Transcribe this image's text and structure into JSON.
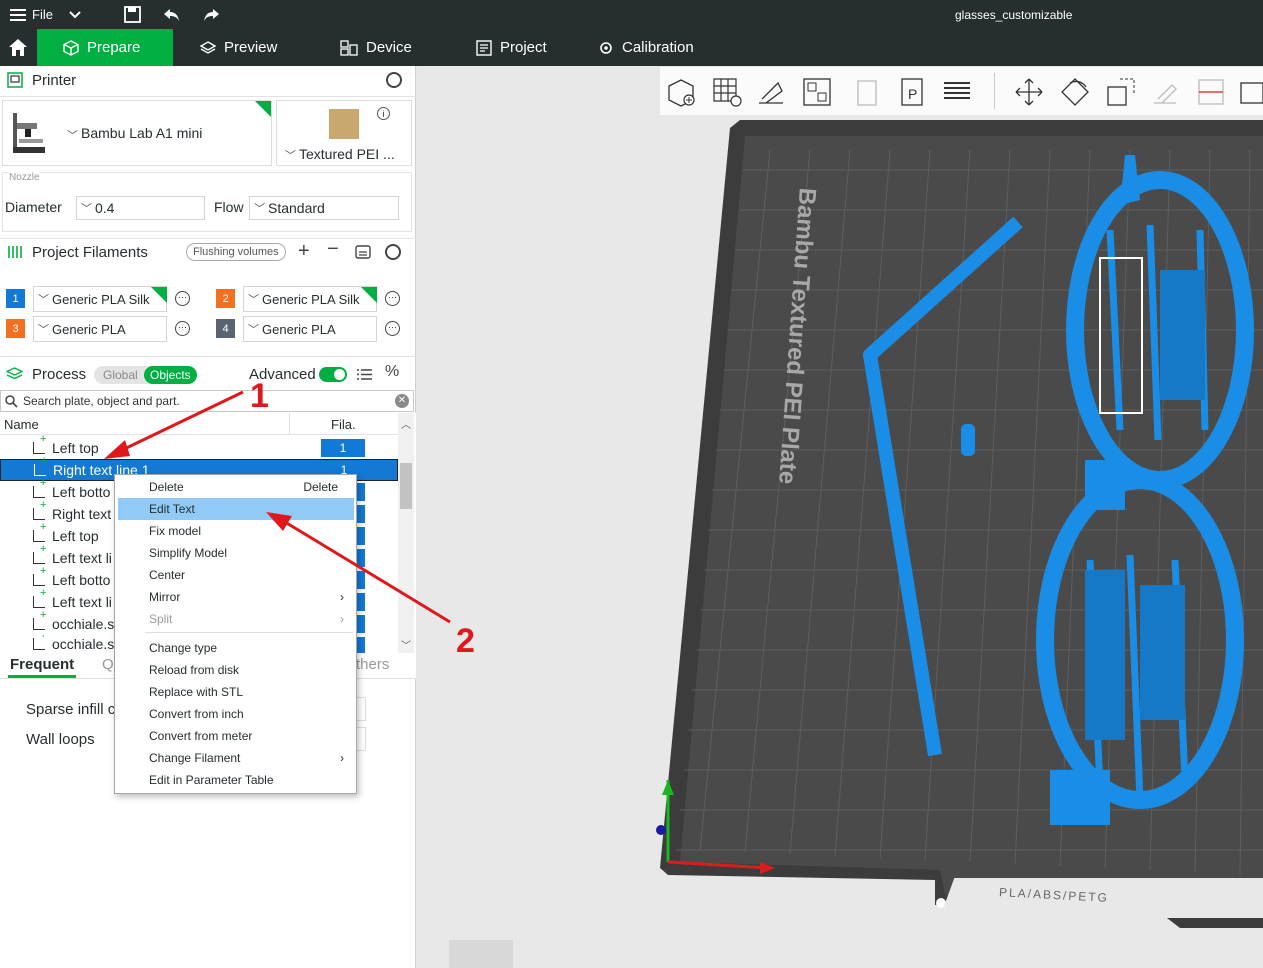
{
  "titlebar": {
    "menu_label": "File",
    "doc_title": "glasses_customizable"
  },
  "tabs": [
    {
      "label": "Prepare",
      "icon": "cube-icon",
      "active": true
    },
    {
      "label": "Preview",
      "icon": "layers-icon",
      "active": false
    },
    {
      "label": "Device",
      "icon": "device-icon",
      "active": false
    },
    {
      "label": "Project",
      "icon": "project-icon",
      "active": false
    },
    {
      "label": "Calibration",
      "icon": "calibration-icon",
      "active": false
    }
  ],
  "printer": {
    "section_title": "Printer",
    "model": "Bambu Lab A1 mini",
    "plate": "Textured PEI ...",
    "nozzle_label": "Nozzle",
    "diameter_label": "Diameter",
    "diameter_value": "0.4",
    "flow_label": "Flow",
    "flow_value": "Standard"
  },
  "filaments": {
    "section_title": "Project Filaments",
    "flushing_label": "Flushing volumes",
    "items": [
      {
        "num": "1",
        "name": "Generic PLA Silk",
        "color": "#1479d2"
      },
      {
        "num": "2",
        "name": "Generic PLA Silk",
        "color": "#f37021"
      },
      {
        "num": "3",
        "name": "Generic PLA",
        "color": "#f37021"
      },
      {
        "num": "4",
        "name": "Generic PLA",
        "color": "#5a6470"
      }
    ]
  },
  "process": {
    "section_title": "Process",
    "global_label": "Global",
    "objects_label": "Objects",
    "advanced_label": "Advanced",
    "search_placeholder": "Search plate, object and part."
  },
  "objects": {
    "col_name": "Name",
    "col_fila": "Fila.",
    "rows": [
      {
        "label": "Left top",
        "fila": "1"
      },
      {
        "label": "Right text line 1",
        "fila": "1"
      },
      {
        "label": "Left botto",
        "fila": ""
      },
      {
        "label": "Right text",
        "fila": ""
      },
      {
        "label": "Left top",
        "fila": ""
      },
      {
        "label": "Left text li",
        "fila": ""
      },
      {
        "label": "Left botto",
        "fila": ""
      },
      {
        "label": "Left text li",
        "fila": ""
      },
      {
        "label": "occhiale.st",
        "fila": ""
      },
      {
        "label": "occhiale.st",
        "fila": ""
      }
    ]
  },
  "settings_tabs": {
    "frequent": "Frequent",
    "quality_abbrev": "Q",
    "others_abbrev": "thers"
  },
  "settings": {
    "sparse_infill_label": "Sparse infill c",
    "wall_loops_label": "Wall loops"
  },
  "context_menu": {
    "items": [
      {
        "label": "Delete",
        "shortcut": "Delete"
      },
      {
        "label": "Edit Text",
        "highlight": true
      },
      {
        "label": "Fix model"
      },
      {
        "label": "Simplify Model"
      },
      {
        "label": "Center"
      },
      {
        "label": "Mirror",
        "submenu": true
      },
      {
        "label": "Split",
        "submenu": true,
        "disabled": true
      },
      {
        "label": "Change type"
      },
      {
        "label": "Reload from disk"
      },
      {
        "label": "Replace with STL"
      },
      {
        "label": "Convert from inch"
      },
      {
        "label": "Convert from meter"
      },
      {
        "label": "Change Filament",
        "submenu": true
      },
      {
        "label": "Edit in Parameter Table"
      }
    ]
  },
  "viewport": {
    "plate_label": "Bambu Textured PEI Plate",
    "plate_footer": "PLA/ABS/PETG",
    "model_color": "#1a8ee6",
    "plate_color": "#3a3a3a"
  },
  "annotations": {
    "marker_1": "1",
    "marker_2": "2",
    "color": "#e0181b"
  }
}
